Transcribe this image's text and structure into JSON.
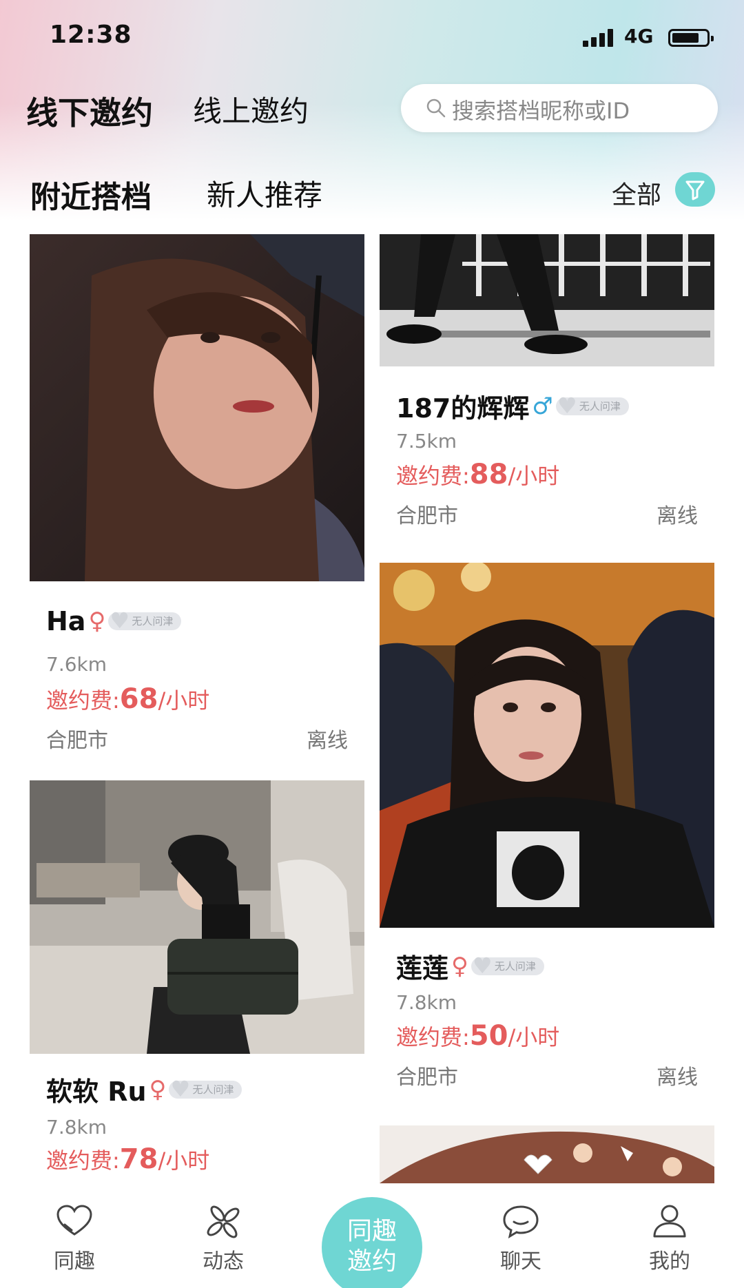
{
  "status_bar": {
    "time": "12:38",
    "network": "4G"
  },
  "top_tabs": [
    {
      "label": "线下邀约",
      "active": true
    },
    {
      "label": "线上邀约",
      "active": false
    }
  ],
  "search": {
    "placeholder": "搜索搭档昵称或ID"
  },
  "sub_tabs": [
    {
      "label": "附近搭档",
      "active": true
    },
    {
      "label": "新人推荐",
      "active": false
    }
  ],
  "filter": {
    "label": "全部",
    "icon": "filter-icon"
  },
  "badge_text": "无人问津",
  "cards": [
    {
      "nickname": "Ha",
      "gender": "♀",
      "distance": "7.6km",
      "fee_label": "邀约费:",
      "fee_value": "68",
      "fee_unit": "/小时",
      "city": "合肥市",
      "status": "离线"
    },
    {
      "nickname": "187的辉辉",
      "gender": "♂",
      "distance": "7.5km",
      "fee_label": "邀约费:",
      "fee_value": "88",
      "fee_unit": "/小时",
      "city": "合肥市",
      "status": "离线"
    },
    {
      "nickname": "莲莲",
      "gender": "♀",
      "distance": "7.8km",
      "fee_label": "邀约费:",
      "fee_value": "50",
      "fee_unit": "/小时",
      "city": "合肥市",
      "status": "离线"
    },
    {
      "nickname": "软软 Ru",
      "gender": "♀",
      "distance": "7.8km",
      "fee_label": "邀约费:",
      "fee_value": "78",
      "fee_unit": "/小时"
    }
  ],
  "bottom_nav": [
    {
      "label": "同趣",
      "icon": "heart-icon"
    },
    {
      "label": "动态",
      "icon": "pinwheel-icon"
    },
    {
      "label": "同趣邀约",
      "line1": "同趣",
      "line2": "邀约",
      "icon": "center-invite-button"
    },
    {
      "label": "聊天",
      "icon": "chat-bubble-icon"
    },
    {
      "label": "我的",
      "icon": "person-icon"
    }
  ],
  "colors": {
    "accent": "#6fd6d3",
    "fee": "#e45c5c",
    "female": "#e66a6a",
    "male": "#37a6d8"
  }
}
